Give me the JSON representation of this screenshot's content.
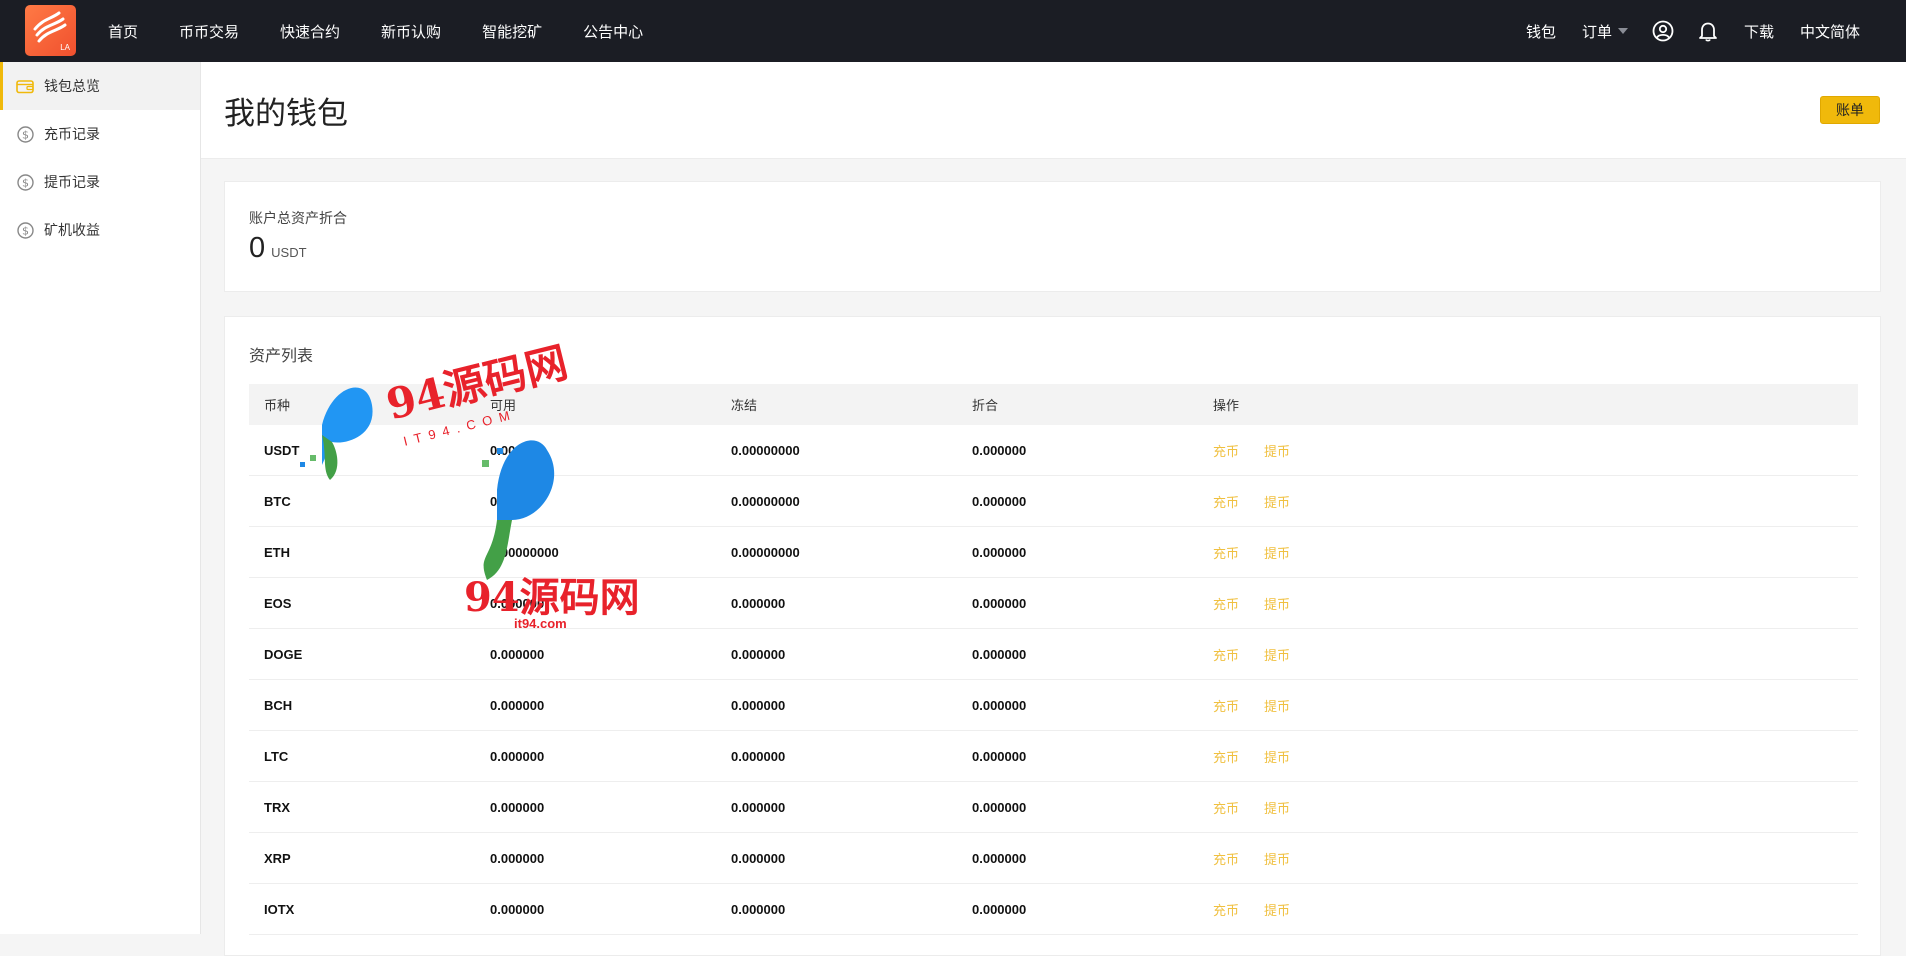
{
  "topbar": {
    "logo_text": "LA",
    "nav": [
      "首页",
      "币币交易",
      "快速合约",
      "新币认购",
      "智能挖矿",
      "公告中心"
    ],
    "right": {
      "wallet": "钱包",
      "orders": "订单",
      "download": "下载",
      "language": "中文简体"
    },
    "icons": [
      "user-icon",
      "bell-icon"
    ]
  },
  "sidebar": {
    "items": [
      {
        "label": "钱包总览",
        "icon": "wallet-icon",
        "active": true
      },
      {
        "label": "充币记录",
        "icon": "dollar-icon",
        "active": false
      },
      {
        "label": "提币记录",
        "icon": "dollar-icon",
        "active": false
      },
      {
        "label": "矿机收益",
        "icon": "dollar-icon",
        "active": false
      }
    ]
  },
  "header": {
    "title": "我的钱包",
    "bill_button": "账单"
  },
  "total": {
    "label": "账户总资产折合",
    "value": "0",
    "unit": "USDT"
  },
  "assets": {
    "title": "资产列表",
    "columns": [
      "币种",
      "可用",
      "冻结",
      "折合",
      "操作"
    ],
    "actions": [
      "充币",
      "提币"
    ],
    "rows": [
      {
        "coin": "USDT",
        "available": "0.000",
        "frozen": "0.00000000",
        "value": "0.000000"
      },
      {
        "coin": "BTC",
        "available": "0",
        "frozen": "0.00000000",
        "value": "0.000000"
      },
      {
        "coin": "ETH",
        "available": "0.00000000",
        "frozen": "0.00000000",
        "value": "0.000000"
      },
      {
        "coin": "EOS",
        "available": "0.000000",
        "frozen": "0.000000",
        "value": "0.000000"
      },
      {
        "coin": "DOGE",
        "available": "0.000000",
        "frozen": "0.000000",
        "value": "0.000000"
      },
      {
        "coin": "BCH",
        "available": "0.000000",
        "frozen": "0.000000",
        "value": "0.000000"
      },
      {
        "coin": "LTC",
        "available": "0.000000",
        "frozen": "0.000000",
        "value": "0.000000"
      },
      {
        "coin": "TRX",
        "available": "0.000000",
        "frozen": "0.000000",
        "value": "0.000000"
      },
      {
        "coin": "XRP",
        "available": "0.000000",
        "frozen": "0.000000",
        "value": "0.000000"
      },
      {
        "coin": "IOTX",
        "available": "0.000000",
        "frozen": "0.000000",
        "value": "0.000000"
      }
    ]
  },
  "watermark": {
    "text_top": "94源码网",
    "text_url_top": "IT94.COM",
    "text_bottom": "94源码网",
    "text_url_bottom": "it94.com"
  },
  "colors": {
    "topbar": "#1b1d24",
    "accent": "#f0b90b",
    "action_link": "#f0c040",
    "watermark_red": "#e8222b",
    "watermark_blue": "#1e88e5"
  }
}
